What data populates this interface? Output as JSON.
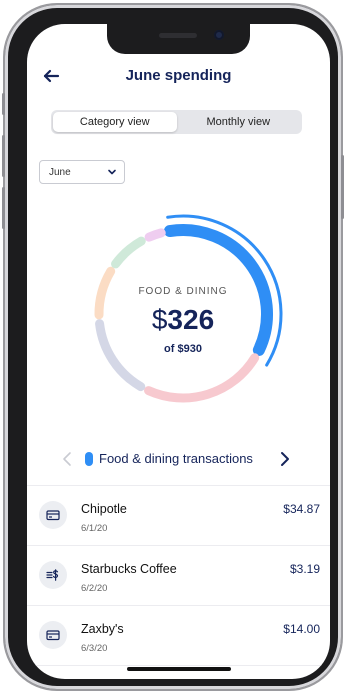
{
  "header": {
    "title": "June spending",
    "back_icon": "arrow-left-icon"
  },
  "view_toggle": {
    "options": [
      {
        "label": "Category view",
        "active": true
      },
      {
        "label": "Monthly view",
        "active": false
      }
    ]
  },
  "month_select": {
    "selected": "June",
    "icon": "chevron-down-icon"
  },
  "summary": {
    "category": "FOOD & DINING",
    "currency": "$",
    "amount": "326",
    "total_text": "of $930"
  },
  "chart_data": {
    "type": "pie",
    "style": "segmented-donut",
    "total": 930,
    "highlighted": "Food & dining",
    "colors": {
      "highlight": "#2f8ef5",
      "pink": "#f7c9cf",
      "lavender": "#d4d7e6",
      "peach": "#fbdcc4",
      "mint": "#cfe9d9",
      "lilac": "#efcdf0"
    },
    "slices": [
      {
        "label": "Food & dining",
        "value": 326,
        "color": "#2f8ef5"
      },
      {
        "value": 222,
        "color": "#f7c9cf"
      },
      {
        "value": 148,
        "color": "#d4d7e6"
      },
      {
        "value": 93,
        "color": "#fbdcc4"
      },
      {
        "value": 74,
        "color": "#cfe9d9"
      },
      {
        "value": 37,
        "color": "#efcdf0"
      }
    ]
  },
  "transactions_nav": {
    "label": "Food & dining transactions",
    "prev_icon": "chevron-left-icon",
    "next_icon": "chevron-right-icon",
    "accent": "#2f8ef5"
  },
  "transactions": [
    {
      "name": "Chipotle",
      "date": "6/1/20",
      "amount": "$34.87",
      "icon": "credit-card-icon"
    },
    {
      "name": "Starbucks Coffee",
      "date": "6/2/20",
      "amount": "$3.19",
      "icon": "transfer-dollar-icon"
    },
    {
      "name": "Zaxby's",
      "date": "6/3/20",
      "amount": "$14.00",
      "icon": "credit-card-icon"
    }
  ],
  "colors": {
    "navy": "#15245a",
    "divider": "#ececf0"
  }
}
